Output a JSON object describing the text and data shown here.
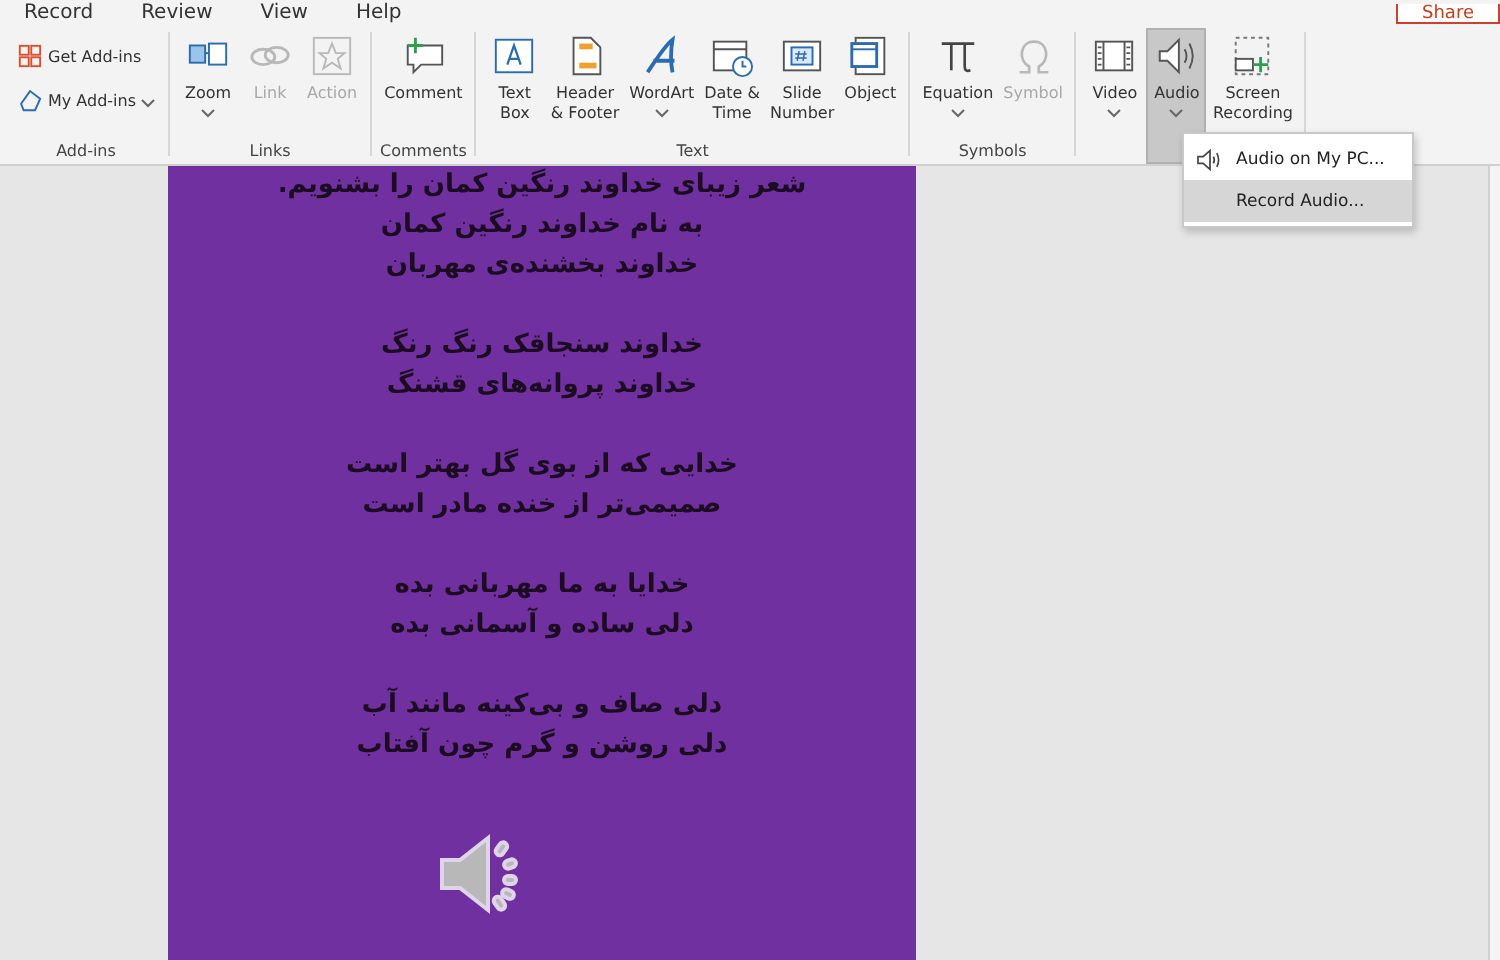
{
  "tabs": [
    {
      "label": "Record"
    },
    {
      "label": "Review"
    },
    {
      "label": "View"
    },
    {
      "label": "Help"
    }
  ],
  "share_button": {
    "label": "Share"
  },
  "ribbon": {
    "groups": [
      {
        "label": "Add-ins",
        "commands": [
          {
            "kind": "small",
            "label": "Get Add-ins",
            "caret": false,
            "disabled": false
          },
          {
            "kind": "small",
            "label": "My Add-ins",
            "caret": true,
            "disabled": false
          }
        ]
      },
      {
        "label": "Links",
        "commands": [
          {
            "kind": "large",
            "label": "Zoom",
            "caret": true,
            "disabled": false,
            "selected": false
          },
          {
            "kind": "large",
            "label": "Link",
            "caret": false,
            "disabled": true,
            "selected": false
          },
          {
            "kind": "large",
            "label": "Action",
            "caret": false,
            "disabled": true,
            "selected": false
          }
        ]
      },
      {
        "label": "Comments",
        "commands": [
          {
            "kind": "large",
            "label": "Comment",
            "caret": false,
            "disabled": false,
            "selected": false
          }
        ]
      },
      {
        "label": "Text",
        "commands": [
          {
            "kind": "large",
            "label": "Text\nBox",
            "caret": false,
            "disabled": false,
            "selected": false
          },
          {
            "kind": "large",
            "label": "Header\n& Footer",
            "caret": false,
            "disabled": false,
            "selected": false
          },
          {
            "kind": "large",
            "label": "WordArt",
            "caret": true,
            "disabled": false,
            "selected": false
          },
          {
            "kind": "large",
            "label": "Date &\nTime",
            "caret": false,
            "disabled": false,
            "selected": false
          },
          {
            "kind": "large",
            "label": "Slide\nNumber",
            "caret": false,
            "disabled": false,
            "selected": false
          },
          {
            "kind": "large",
            "label": "Object",
            "caret": false,
            "disabled": false,
            "selected": false
          }
        ]
      },
      {
        "label": "Symbols",
        "commands": [
          {
            "kind": "large",
            "label": "Equation",
            "caret": true,
            "disabled": false,
            "selected": false
          },
          {
            "kind": "large",
            "label": "Symbol",
            "caret": false,
            "disabled": true,
            "selected": false
          }
        ]
      },
      {
        "commands": [
          {
            "kind": "large",
            "label": "Video",
            "caret": true,
            "disabled": false,
            "selected": false
          },
          {
            "kind": "large",
            "label": "Audio",
            "caret": true,
            "disabled": false,
            "selected": true
          },
          {
            "kind": "large",
            "label": "Screen\nRecording",
            "caret": false,
            "disabled": false,
            "selected": false
          }
        ]
      }
    ]
  },
  "audio_menu": {
    "items": [
      {
        "label": "Audio on My PC...",
        "icon": true,
        "selected": false
      },
      {
        "label": "Record Audio...",
        "icon": false,
        "selected": true
      }
    ]
  },
  "slide": {
    "stanzas": [
      [
        "شعر زیبای خداوند رنگین کمان را بشنویم.",
        "به نام خداوند رنگین کمان",
        "خداوند بخشنده‌ی مهربان"
      ],
      [
        "خداوند سنجاقک رنگ رنگ",
        "خداوند پروانه‌های قشنگ"
      ],
      [
        "خدایی که از بوی گل بهتر است",
        "صمیمی‌تر از خنده مادر است"
      ],
      [
        "خدایا به ما مهربانی بده",
        "دلی ساده و آسمانی بده"
      ],
      [
        "دلی صاف و بی‌کینه مانند آب",
        "دلی روشن و گرم چون آفتاب"
      ]
    ]
  }
}
